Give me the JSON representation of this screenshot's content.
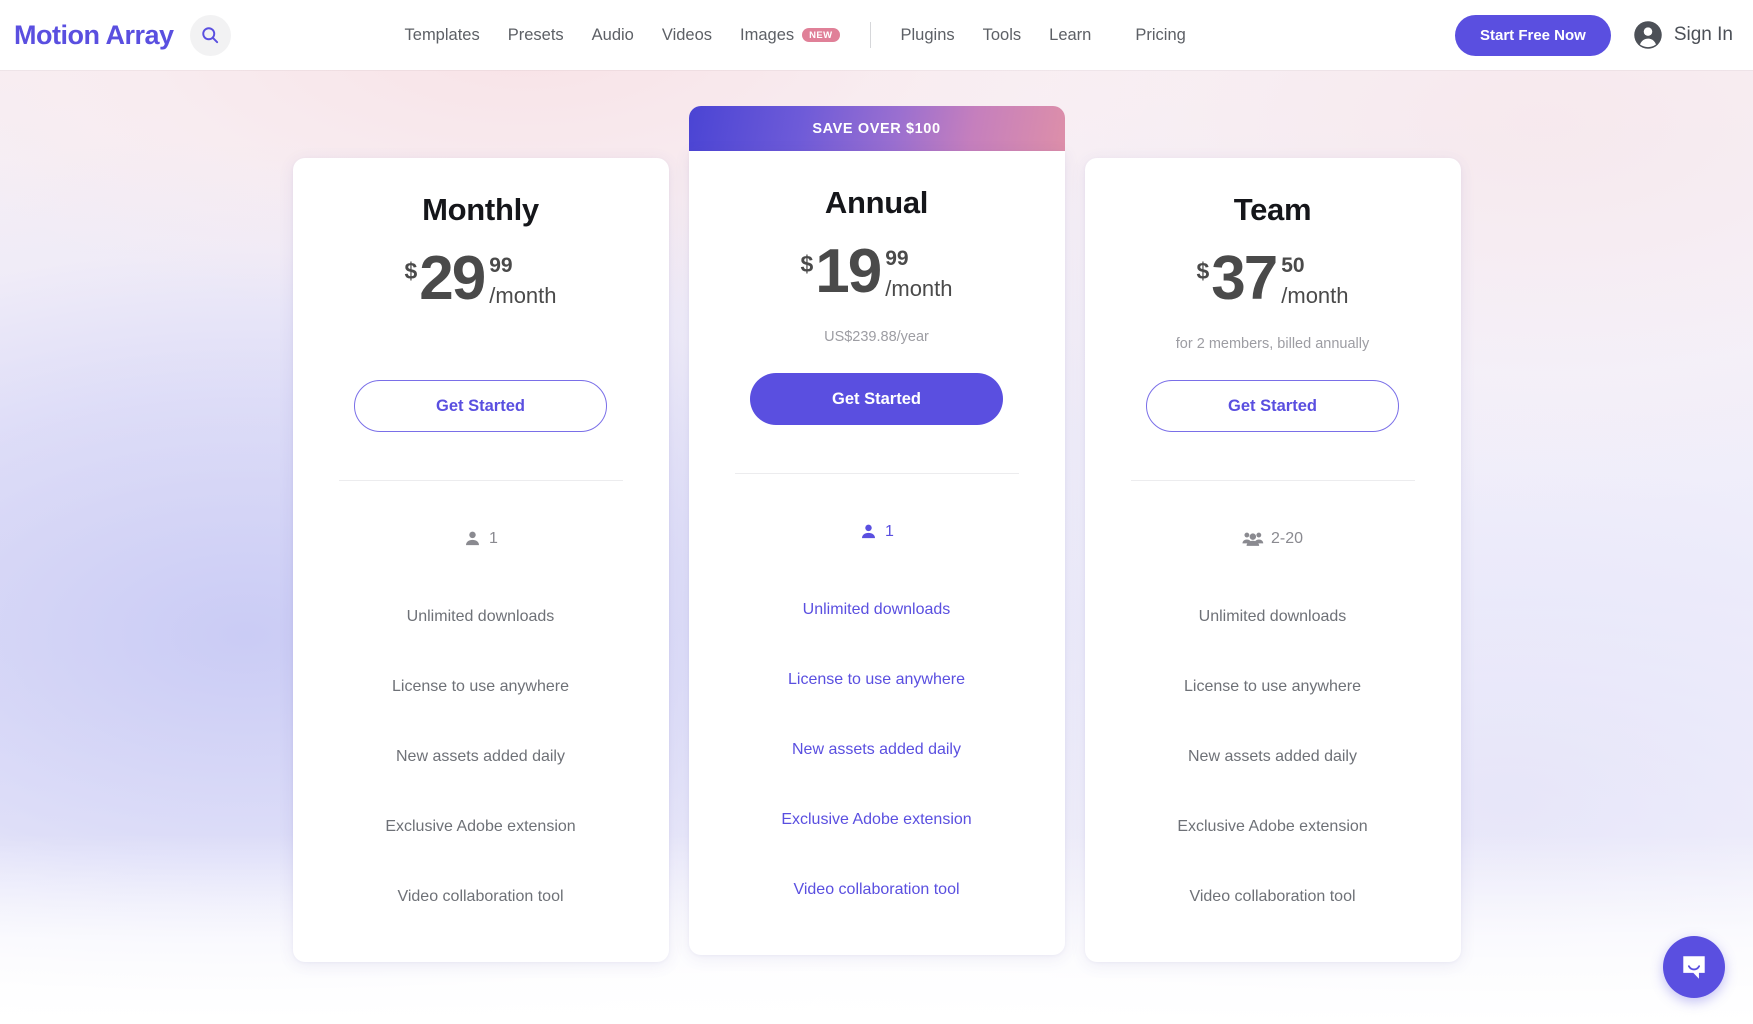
{
  "header": {
    "logo_text": "Motion Array",
    "search_icon": "search-icon",
    "nav_items": [
      {
        "label": "Templates",
        "badge": null
      },
      {
        "label": "Presets",
        "badge": null
      },
      {
        "label": "Audio",
        "badge": null
      },
      {
        "label": "Videos",
        "badge": null
      },
      {
        "label": "Images",
        "badge": "NEW"
      }
    ],
    "nav_items_secondary": [
      {
        "label": "Plugins"
      },
      {
        "label": "Tools"
      },
      {
        "label": "Learn"
      },
      {
        "label": "Pricing"
      }
    ],
    "cta_label": "Start Free Now",
    "signin_label": "Sign In",
    "avatar_icon": "user-circle-icon"
  },
  "colors": {
    "brand_indigo": "#5a4fe0",
    "badge_pink": "#e08098",
    "text_gray": "#6e7177",
    "muted_gray": "#9d9da3",
    "heading_black": "#15161a",
    "price_gray": "#4a4a4a"
  },
  "plans": [
    {
      "name": "Monthly",
      "banner": null,
      "currency": "$",
      "amount": "29",
      "cents": "99",
      "per": "/month",
      "sub_note": "",
      "cta_label": "Get Started",
      "cta_style": "outline",
      "seats_icon": "person-icon",
      "seats_label": "1",
      "highlighted": false,
      "features": [
        "Unlimited downloads",
        "License to use anywhere",
        "New assets added daily",
        "Exclusive Adobe extension",
        "Video collaboration tool"
      ]
    },
    {
      "name": "Annual",
      "banner": "SAVE OVER $100",
      "currency": "$",
      "amount": "19",
      "cents": "99",
      "per": "/month",
      "sub_note": "US$239.88/year",
      "cta_label": "Get Started",
      "cta_style": "filled",
      "seats_icon": "person-icon",
      "seats_label": "1",
      "highlighted": true,
      "features": [
        "Unlimited downloads",
        "License to use anywhere",
        "New assets added daily",
        "Exclusive Adobe extension",
        "Video collaboration tool"
      ]
    },
    {
      "name": "Team",
      "banner": null,
      "currency": "$",
      "amount": "37",
      "cents": "50",
      "per": "/month",
      "sub_note": "for 2 members, billed annually",
      "cta_label": "Get Started",
      "cta_style": "outline",
      "seats_icon": "people-group-icon",
      "seats_label": "2-20",
      "highlighted": false,
      "features": [
        "Unlimited downloads",
        "License to use anywhere",
        "New assets added daily",
        "Exclusive Adobe extension",
        "Video collaboration tool"
      ]
    }
  ],
  "chat": {
    "icon": "chat-bubble-smile-icon"
  }
}
